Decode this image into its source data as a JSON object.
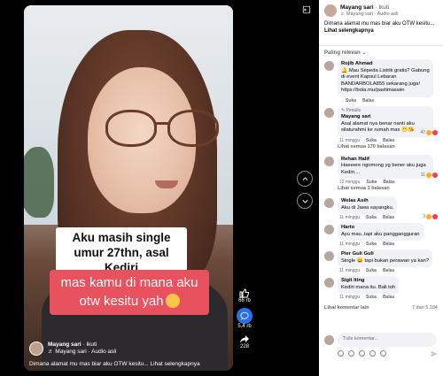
{
  "video": {
    "caption_top": "Aku masih single umur 27thn, asal Kediri",
    "caption_bottom": "mas kamu di mana aku otw kesitu yah",
    "author_name": "Mayang sari",
    "follow_label": "· Ikuti",
    "author_sub": "♬ Mayang sari · Audio asli",
    "description": "Dimana alamat mu mas biar aku OTW kesitu... Lihat selengkapnya",
    "likes": "66 rb",
    "comments": "5,4 rb",
    "shares": "228"
  },
  "panel": {
    "author_name": "Mayang sari",
    "follow_label": "· Ikuti",
    "author_sub": "♬ Mayang sari · Audio asli",
    "caption": "Dimana alamat mu mas biar aku OTW kesitu...",
    "caption_more": "Lihat selengkapnya",
    "sort_label": "Paling relevan ⌄",
    "comments": [
      {
        "name": "Rojib Ahmad",
        "text": "🔔 Mau Sepeda Listrik gratis? Gabung di event Kapsul Lebaran BANDARBOLA855 sekarang juga! https://bola.mu/pastimaswin",
        "time": "",
        "like": "Suka",
        "reply": "Balas",
        "reactions": ""
      },
      {
        "lead": "✎ Penulis",
        "name": "Mayang sari",
        "text": "Asal alamat nya benar nanti aku silaturahmi ke rumah mas 😁😘",
        "time": "11 minggu",
        "like": "Suka",
        "reply": "Balas",
        "reactions": "47",
        "view": "Lihat semua 170 balasan"
      },
      {
        "name": "Rehan Halif",
        "text": "Haeeere ngomong yg bener aku juga Kediri....",
        "time": "12 minggu",
        "like": "Suka",
        "reply": "Balas",
        "reactions": "11",
        "view": "Lihat semua 3 balasan"
      },
      {
        "name": "Welas Asih",
        "text": "Aku di Jawa sayangku.",
        "time": "11 minggu",
        "like": "Suka",
        "reply": "Balas",
        "reactions": "3"
      },
      {
        "name": "Harto",
        "text": "Ayu mau..tapi aku panggangguran",
        "time": "11 minggu",
        "like": "Suka",
        "reply": "Balas",
        "reactions": ""
      },
      {
        "name": "Pier Guli Guli",
        "text": "Single 😄 tapi bukan perawan ya kan?",
        "time": "11 minggu",
        "like": "Suka",
        "reply": "Balas",
        "reactions": ""
      },
      {
        "name": "Sigit Iting",
        "text": "Kediri mana itu. Bali toh",
        "time": "11 minggu",
        "like": "Suka",
        "reply": "Balas",
        "reactions": ""
      }
    ],
    "more_comments": "Lihat komentar lain",
    "count": "7 dari 5.184",
    "composer_placeholder": "Tulis komentar..."
  }
}
